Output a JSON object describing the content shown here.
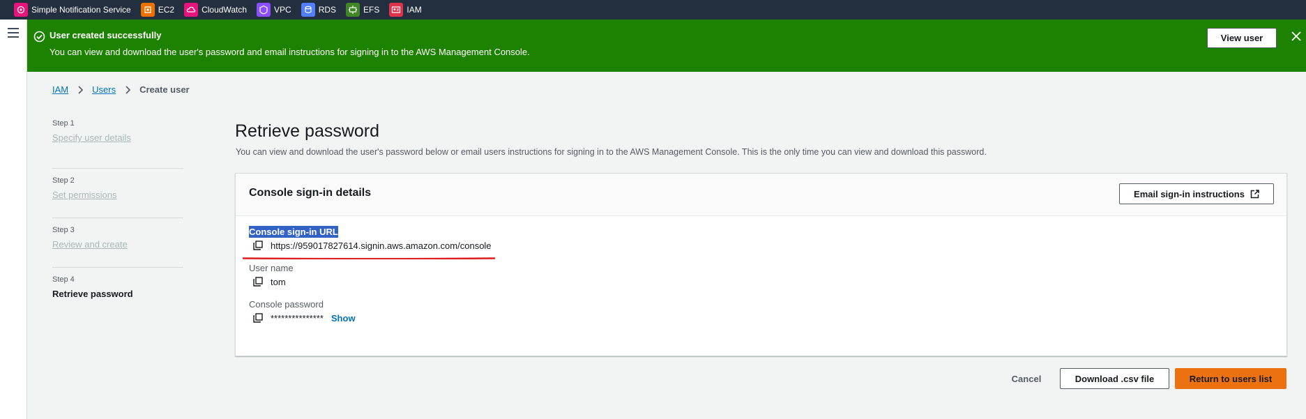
{
  "services": [
    {
      "label": "Simple Notification Service",
      "icon": "sns-icon",
      "color": "#e7157b"
    },
    {
      "label": "EC2",
      "icon": "ec2-icon",
      "color": "#ed7100"
    },
    {
      "label": "CloudWatch",
      "icon": "cloudwatch-icon",
      "color": "#e7157b"
    },
    {
      "label": "VPC",
      "icon": "vpc-icon",
      "color": "#8c4fff"
    },
    {
      "label": "RDS",
      "icon": "rds-icon",
      "color": "#527fff"
    },
    {
      "label": "EFS",
      "icon": "efs-icon",
      "color": "#3f8624"
    },
    {
      "label": "IAM",
      "icon": "iam-icon",
      "color": "#dd344c"
    }
  ],
  "flash": {
    "title": "User created successfully",
    "message": "You can view and download the user's password and email instructions for signing in to the AWS Management Console.",
    "action_label": "View user",
    "color": "#1d8102"
  },
  "breadcrumb": {
    "items": [
      "IAM",
      "Users"
    ],
    "current": "Create user"
  },
  "steps": [
    {
      "number": "Step 1",
      "label": "Specify user details",
      "active": false
    },
    {
      "number": "Step 2",
      "label": "Set permissions",
      "active": false
    },
    {
      "number": "Step 3",
      "label": "Review and create",
      "active": false
    },
    {
      "number": "Step 4",
      "label": "Retrieve password",
      "active": true
    }
  ],
  "page": {
    "title": "Retrieve password",
    "description": "You can view and download the user's password below or email users instructions for signing in to the AWS Management Console. This is the only time you can view and download this password."
  },
  "panel": {
    "title": "Console sign-in details",
    "email_button": "Email sign-in instructions",
    "url_label": "Console sign-in URL",
    "url_value": "https://959017827614.signin.aws.amazon.com/console",
    "username_label": "User name",
    "username_value": "tom",
    "password_label": "Console password",
    "password_value": "***************",
    "show_label": "Show"
  },
  "actions": {
    "cancel": "Cancel",
    "download": "Download .csv file",
    "return": "Return to users list",
    "primary_color": "#ec7211"
  }
}
